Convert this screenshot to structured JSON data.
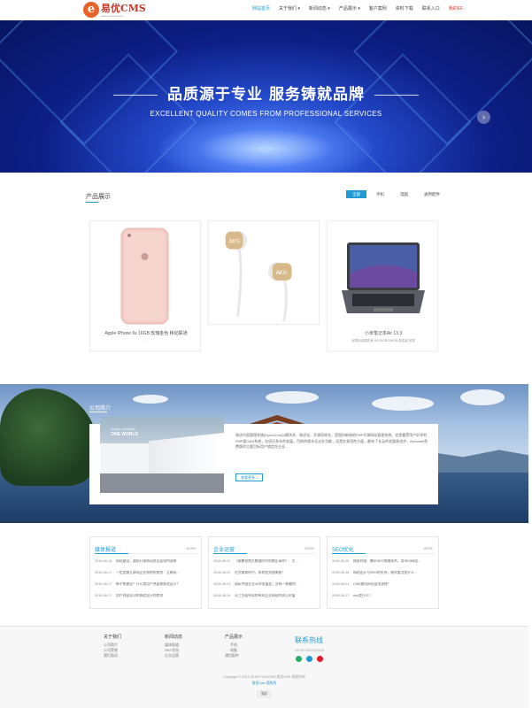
{
  "logo": {
    "brand": "易优CMS",
    "sub": "www.eyoucms.com",
    "mark": "e"
  },
  "nav": {
    "items": [
      {
        "label": "网站首页",
        "active": true
      },
      {
        "label": "关于我们 ▾"
      },
      {
        "label": "新闻动态 ▾"
      },
      {
        "label": "产品展示 ▾"
      },
      {
        "label": "客户案例"
      },
      {
        "label": "资料下载"
      },
      {
        "label": "联系入口"
      },
      {
        "label": "我的EF",
        "red": true
      }
    ]
  },
  "hero": {
    "title": "品质源于专业 服务铸就品牌",
    "subtitle": "EXCELLENT QUALITY COMES FROM PROFESSIONAL SERVICES",
    "next_icon": "chevron-right-icon",
    "next_glyph": "›",
    "slides": 3,
    "active_slide": 1
  },
  "products": {
    "title": "产品展示",
    "tabs": [
      {
        "label": "全部",
        "active": true
      },
      {
        "label": "手机"
      },
      {
        "label": "电脑"
      },
      {
        "label": "通用配件"
      }
    ],
    "items": [
      {
        "name": "Apple iPhone 6s 16GB 玫瑰金色 移动联通",
        "desc": "..."
      },
      {
        "name": "",
        "desc": ""
      },
      {
        "name": "小米笔记本Air 13.3",
        "desc": "轻薄全金属机身 i5/i7/8GB/256GB 高性能 轻薄"
      }
    ]
  },
  "about": {
    "title": "公司简介",
    "photo_title": "ONE WORLD",
    "photo_sub": "GLOBAL BUSINESS",
    "text": "易优内容管理系统(EyouCms)以模块多、易优化、开源而闻名，是国内新锐的PHP开源网站管理系统，也是最受用户好评的PHP类CMS系统，在经历多年的发展，目前的版本无论在功能，还是在易用性方面，都有了长足的发展和进步，eyoucms免费版的主要目标用户锁定在企业...",
    "more": "查看更多 >"
  },
  "news": [
    {
      "title": "媒体报道",
      "more": "MORE",
      "rows": [
        {
          "date": "2018-06-18",
          "text": "网站建设，建站开源和动态页面如何选择"
        },
        {
          "date": "2018-06-17",
          "text": "一定是做互联网企业和他的策划：互联网..."
        },
        {
          "date": "2018-06-17",
          "text": "新手和建设？什么是用户界面和体验设计？"
        },
        {
          "date": "2018-06-17",
          "text": "用户界面设计和体验设计的差别"
        }
      ]
    },
    {
      "title": "企业运营",
      "more": "MORE",
      "rows": [
        {
          "date": "2018-06-01",
          "text": "《颠覆营销大数据时代的商业革命》：大..."
        },
        {
          "date": "2018-06-01",
          "text": "社交媒体时代，如何找到追随者？"
        },
        {
          "date": "2018-06-01",
          "text": "国际中国企业40年发展史，总有一款最你..."
        },
        {
          "date": "2018-06-19",
          "text": "从三方面布局的布局企业网站的核心价值"
        }
      ]
    },
    {
      "title": "SEO优化",
      "more": "MORE",
      "rows": [
        {
          "date": "2018-05-29",
          "text": "搜索时候：腾讯SEO策略技术，用SEO网站..."
        },
        {
          "date": "2018-05-16",
          "text": "网站设计与SEO的关系，需求重点是什么..."
        },
        {
          "date": "2018-06-01",
          "text": "CMS建站网站适用选择？"
        },
        {
          "date": "2018-05-17",
          "text": "seo是什么？"
        }
      ]
    }
  ],
  "footer": {
    "cols": [
      {
        "title": "关于我们",
        "items": [
          "公司简介",
          "公司荣誉",
          "我们面试"
        ]
      },
      {
        "title": "新闻动态",
        "items": [
          "媒体报道",
          "SEO优化",
          "企业运营"
        ]
      },
      {
        "title": "产品展示",
        "items": [
          "手机",
          "电脑",
          "通用配件"
        ]
      }
    ],
    "hotline": "联系热线",
    "phone": "XXXX-XXXXXXXX",
    "copyright": "Copyright © 2013-2018 EYOUCMS 易优CMS 版权所有",
    "powered": "易优Cms 版权所",
    "top": "顶部"
  },
  "colors": {
    "accent": "#1e9bd7",
    "hot": "#e53935",
    "logo": "#e8632a"
  }
}
